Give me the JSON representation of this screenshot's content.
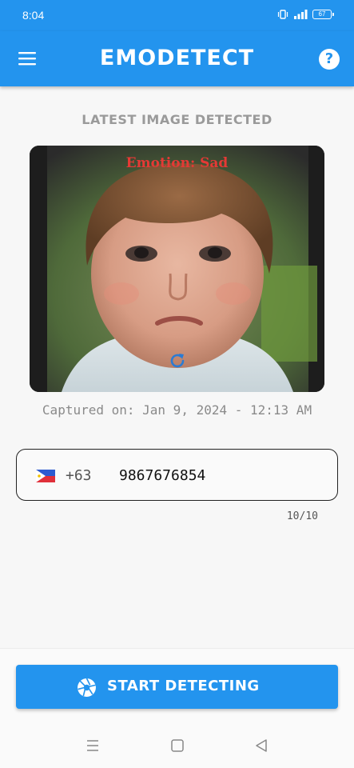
{
  "status_bar": {
    "time": "8:04",
    "battery": "67"
  },
  "app_bar": {
    "title": "EMODETECT",
    "help_label": "?"
  },
  "latest": {
    "heading": "LATEST IMAGE DETECTED",
    "emotion_label": "Emotion: Sad",
    "captured_text": "Captured on: Jan 9, 2024 - 12:13 AM"
  },
  "phone": {
    "country_code": "+63",
    "number": "9867676854",
    "counter": "10/10"
  },
  "actions": {
    "start_label": "START DETECTING"
  },
  "colors": {
    "primary": "#2394ee",
    "emotion_text": "#e53935",
    "background": "#f7f7f7"
  },
  "icons": {
    "menu": "menu-icon",
    "help": "help-icon",
    "refresh": "refresh-icon",
    "flag": "philippines-flag-icon",
    "aperture": "aperture-icon"
  }
}
